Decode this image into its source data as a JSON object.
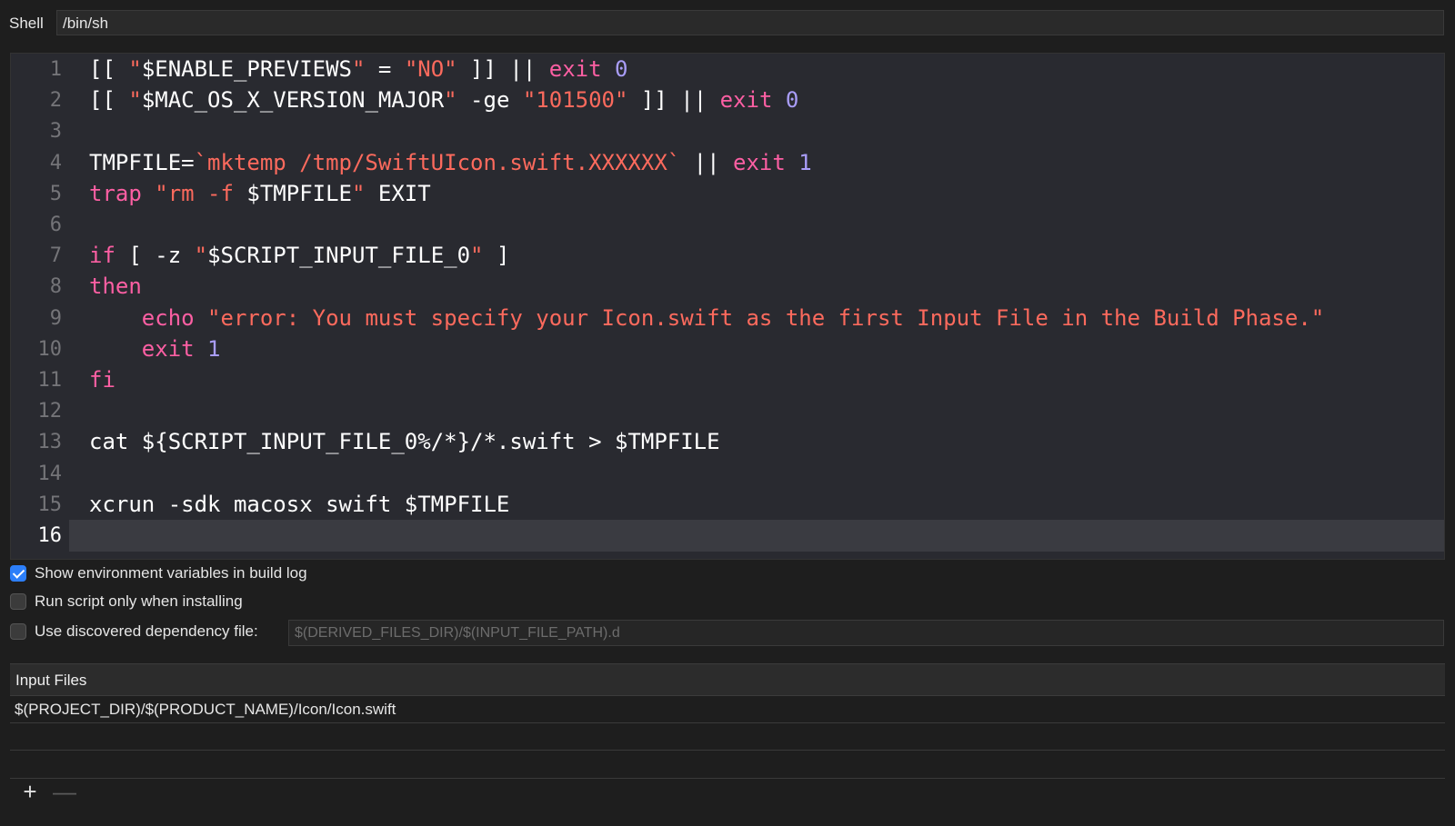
{
  "shell": {
    "label": "Shell",
    "value": "/bin/sh"
  },
  "script_lines": [
    [
      [
        "[[ ",
        "plain"
      ],
      [
        "\"",
        "str"
      ],
      [
        "$ENABLE_PREVIEWS",
        "plain"
      ],
      [
        "\"",
        "str"
      ],
      [
        " = ",
        "plain"
      ],
      [
        "\"NO\"",
        "str"
      ],
      [
        " ]] || ",
        "plain"
      ],
      [
        "exit",
        "kw"
      ],
      [
        " ",
        "plain"
      ],
      [
        "0",
        "num"
      ]
    ],
    [
      [
        "[[ ",
        "plain"
      ],
      [
        "\"",
        "str"
      ],
      [
        "$MAC_OS_X_VERSION_MAJOR",
        "plain"
      ],
      [
        "\"",
        "str"
      ],
      [
        " -ge ",
        "plain"
      ],
      [
        "\"101500\"",
        "str"
      ],
      [
        " ]] || ",
        "plain"
      ],
      [
        "exit",
        "kw"
      ],
      [
        " ",
        "plain"
      ],
      [
        "0",
        "num"
      ]
    ],
    [],
    [
      [
        "TMPFILE=",
        "plain"
      ],
      [
        "`mktemp /tmp/SwiftUIcon.swift.XXXXXX`",
        "str"
      ],
      [
        " || ",
        "plain"
      ],
      [
        "exit",
        "kw"
      ],
      [
        " ",
        "plain"
      ],
      [
        "1",
        "num"
      ]
    ],
    [
      [
        "trap",
        "kw"
      ],
      [
        " ",
        "plain"
      ],
      [
        "\"rm -f ",
        "str"
      ],
      [
        "$TMPFILE",
        "plain"
      ],
      [
        "\"",
        "str"
      ],
      [
        " EXIT",
        "plain"
      ]
    ],
    [],
    [
      [
        "if",
        "kw"
      ],
      [
        " [ -z ",
        "plain"
      ],
      [
        "\"",
        "str"
      ],
      [
        "$SCRIPT_INPUT_FILE_0",
        "plain"
      ],
      [
        "\"",
        "str"
      ],
      [
        " ]",
        "plain"
      ]
    ],
    [
      [
        "then",
        "kw"
      ]
    ],
    [
      [
        "    ",
        "plain"
      ],
      [
        "echo",
        "kw"
      ],
      [
        " ",
        "plain"
      ],
      [
        "\"error: You must specify your Icon.swift as the first Input File in the Build Phase.\"",
        "str"
      ]
    ],
    [
      [
        "    ",
        "plain"
      ],
      [
        "exit",
        "kw"
      ],
      [
        " ",
        "plain"
      ],
      [
        "1",
        "num"
      ]
    ],
    [
      [
        "fi",
        "kw"
      ]
    ],
    [],
    [
      [
        "cat ${SCRIPT_INPUT_FILE_0%/*}/*.swift > $TMPFILE",
        "plain"
      ]
    ],
    [],
    [
      [
        "xcrun -sdk macosx swift $TMPFILE",
        "plain"
      ]
    ],
    []
  ],
  "current_line": 16,
  "options": {
    "show_env": {
      "label": "Show environment variables in build log",
      "checked": true
    },
    "run_only_installing": {
      "label": "Run script only when installing",
      "checked": false
    },
    "use_dep_file": {
      "label": "Use discovered dependency file:",
      "checked": false,
      "placeholder": "$(DERIVED_FILES_DIR)/$(INPUT_FILE_PATH).d"
    }
  },
  "input_files": {
    "title": "Input Files",
    "items": [
      "$(PROJECT_DIR)/$(PRODUCT_NAME)/Icon/Icon.swift",
      ""
    ]
  },
  "toolbar": {
    "add_glyph": "+",
    "remove_glyph": "—"
  },
  "colors": {
    "keyword": "#fc5fa3",
    "string": "#fc6a5d",
    "number": "#a99df8",
    "checkbox_accent": "#2d7ff9"
  }
}
